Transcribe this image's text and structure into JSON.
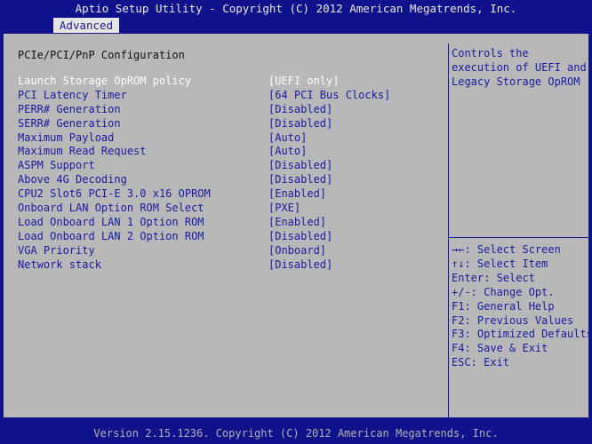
{
  "header": {
    "title": "Aptio Setup Utility - Copyright (C) 2012 American Megatrends, Inc.",
    "tab": "Advanced"
  },
  "main": {
    "page_title": "PCIe/PCI/PnP Configuration",
    "settings": [
      {
        "label": "Launch Storage OpROM policy",
        "value": "[UEFI only]"
      },
      {
        "label": "PCI Latency Timer",
        "value": "[64 PCI Bus Clocks]"
      },
      {
        "label": "PERR# Generation",
        "value": "[Disabled]"
      },
      {
        "label": "SERR# Generation",
        "value": "[Disabled]"
      },
      {
        "label": "Maximum Payload",
        "value": "[Auto]"
      },
      {
        "label": "Maximum Read Request",
        "value": "[Auto]"
      },
      {
        "label": "ASPM Support",
        "value": "[Disabled]"
      },
      {
        "label": "Above 4G Decoding",
        "value": "[Disabled]"
      },
      {
        "label": "CPU2 Slot6 PCI-E 3.0 x16 OPROM",
        "value": "[Enabled]"
      },
      {
        "label": "Onboard LAN Option ROM Select",
        "value": "[PXE]"
      },
      {
        "label": "Load Onboard LAN 1 Option ROM",
        "value": "[Enabled]"
      },
      {
        "label": "Load Onboard LAN 2 Option ROM",
        "value": "[Disabled]"
      },
      {
        "label": "VGA Priority",
        "value": "[Onboard]"
      },
      {
        "label": "Network stack",
        "value": "[Disabled]"
      }
    ]
  },
  "help": {
    "lines": [
      "Controls the",
      "execution of UEFI and",
      "Legacy Storage OpROM"
    ]
  },
  "keys": [
    "→←: Select Screen",
    "↑↓: Select Item",
    "Enter: Select",
    "+/-: Change Opt.",
    "F1: General Help",
    "F2: Previous Values",
    "F3: Optimized Defaults",
    "F4: Save & Exit",
    "ESC: Exit"
  ],
  "footer": "Version 2.15.1236. Copyright (C) 2012 American Megatrends, Inc.",
  "colors": {
    "background": "#0f128a",
    "panel": "#b8b8b8",
    "text_blue": "#1a1aa0",
    "selected_text": "#ffffff"
  }
}
